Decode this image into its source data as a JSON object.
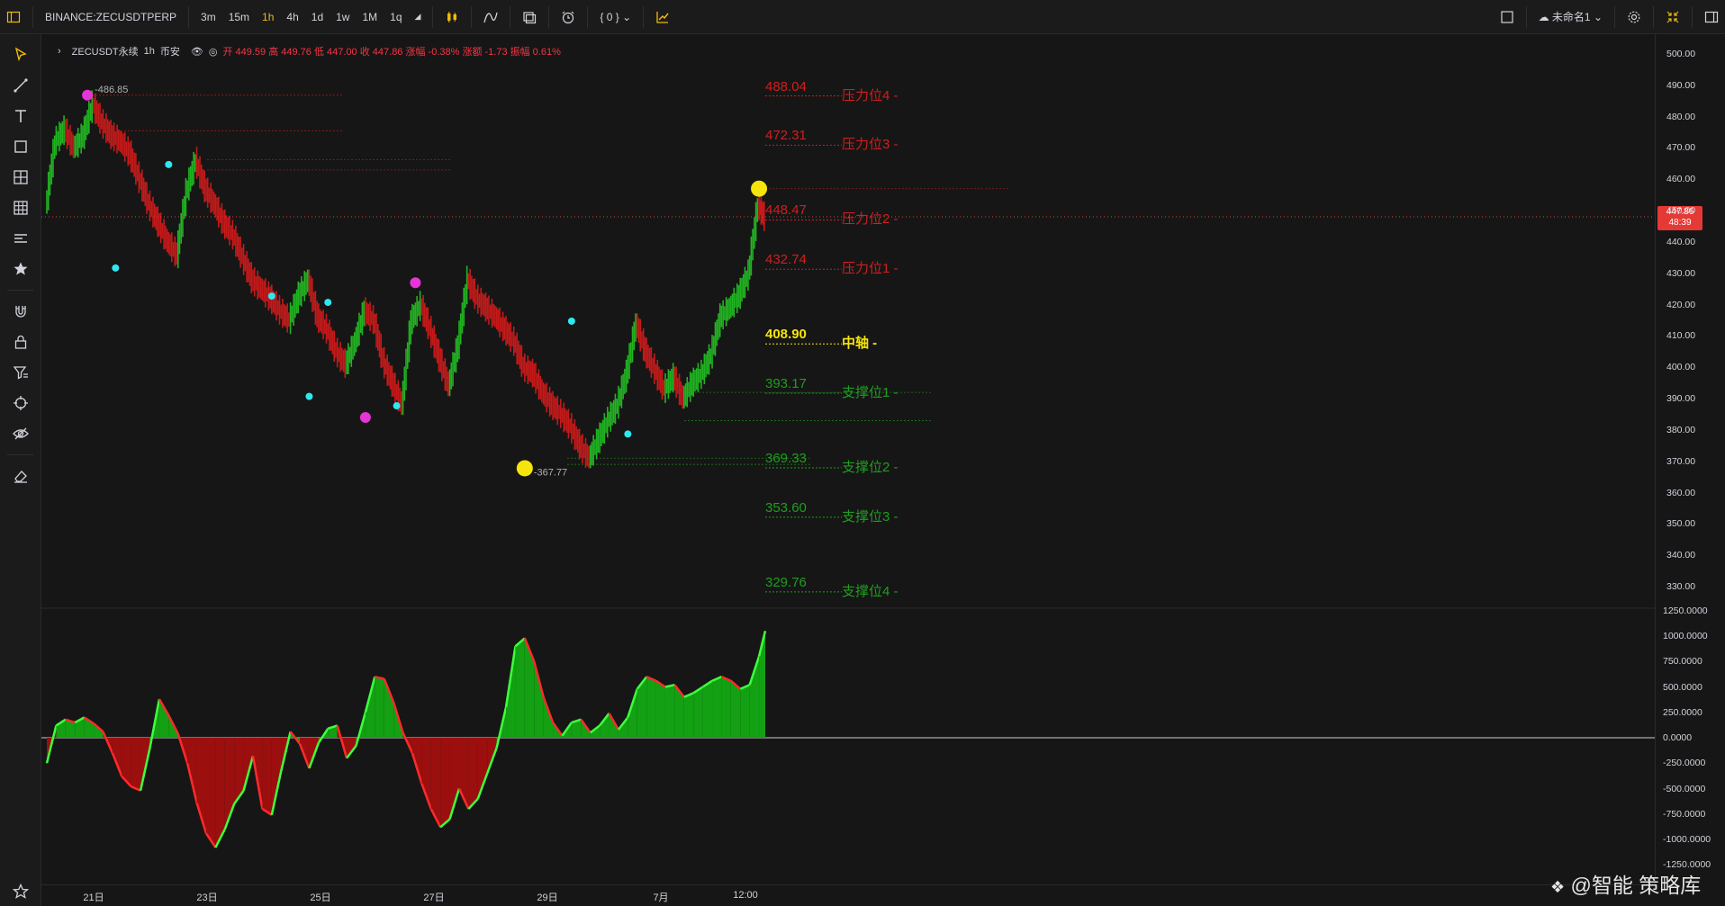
{
  "toolbar": {
    "symbol": "BINANCE:ZECUSDTPERP",
    "intervals": [
      "3m",
      "15m",
      "1h",
      "4h",
      "1d",
      "1w",
      "1M",
      "1q"
    ],
    "active_interval": "1h",
    "indicator_count": "{ 0 }",
    "layout_name": "未命名1"
  },
  "legend": {
    "symbol": "ZECUSDT永续",
    "interval": "1h",
    "exchange": "币安",
    "ohlc": "开 449.59  高 449.76  低 447.00  收 447.86  涨幅 -0.38%  涨额 -1.73  振幅 0.61%"
  },
  "colors": {
    "up": "#22b322",
    "down": "#c41a1a",
    "resistance": "#d21e1e",
    "support": "#1e9e1e",
    "pivot": "#f5e50a",
    "peak_marker": "#e535d6",
    "swing_marker": "#2ee8f0",
    "current_price": "#e53935"
  },
  "current_price_label": {
    "price": "447.86",
    "countdown": "48:39"
  },
  "levels": [
    {
      "value": "488.04",
      "name": "压力位4 -",
      "kind": "resistance"
    },
    {
      "value": "472.31",
      "name": "压力位3 -",
      "kind": "resistance"
    },
    {
      "value": "448.47",
      "name": "压力位2 -",
      "kind": "resistance"
    },
    {
      "value": "432.74",
      "name": "压力位1 -",
      "kind": "resistance"
    },
    {
      "value": "408.90",
      "name": "中轴 -",
      "kind": "pivot"
    },
    {
      "value": "393.17",
      "name": "支撑位1 -",
      "kind": "support"
    },
    {
      "value": "369.33",
      "name": "支撑位2 -",
      "kind": "support"
    },
    {
      "value": "353.60",
      "name": "支撑位3 -",
      "kind": "support"
    },
    {
      "value": "329.76",
      "name": "支撑位4 -",
      "kind": "support"
    }
  ],
  "swing_labels": {
    "high": "486.85",
    "low": "367.77"
  },
  "watermark": "@智能 策略库",
  "chart_data": [
    {
      "type": "line",
      "title": "ZECUSDT永续 1h",
      "price_axis_ticks": [
        "500.00",
        "490.00",
        "480.00",
        "470.00",
        "460.00",
        "450.00",
        "440.00",
        "430.00",
        "420.00",
        "410.00",
        "400.00",
        "390.00",
        "380.00",
        "370.00",
        "360.00",
        "350.00",
        "340.00",
        "330.00"
      ],
      "time_axis_ticks": [
        "21日",
        "23日",
        "25日",
        "27日",
        "29日",
        "7月",
        "12:00"
      ],
      "ylim": [
        325,
        502
      ],
      "x": [
        0,
        6,
        12,
        18,
        24,
        30,
        36,
        42,
        48,
        54,
        60,
        66,
        72,
        78,
        84,
        90,
        96,
        102,
        108,
        114,
        120,
        126,
        132,
        138,
        144,
        150,
        156,
        162,
        168,
        174,
        180,
        186,
        192,
        198,
        204,
        210,
        216,
        222,
        228,
        234,
        240,
        246,
        252,
        258,
        264,
        270,
        276,
        282,
        288,
        294,
        300,
        306,
        312,
        318,
        324,
        330,
        336,
        342,
        348,
        354,
        360,
        366,
        372,
        378,
        384,
        390,
        396,
        402,
        408,
        414,
        420,
        426,
        432,
        438,
        444,
        450,
        456,
        460
      ],
      "close": [
        451,
        472,
        476,
        470,
        474,
        484,
        478,
        474,
        472,
        468,
        460,
        452,
        446,
        440,
        436,
        456,
        466,
        457,
        452,
        446,
        442,
        435,
        428,
        425,
        422,
        418,
        415,
        423,
        428,
        416,
        412,
        405,
        401,
        408,
        418,
        415,
        402,
        395,
        388,
        415,
        420,
        412,
        403,
        394,
        407,
        428,
        422,
        419,
        416,
        412,
        408,
        400,
        398,
        392,
        388,
        385,
        381,
        375,
        371,
        377,
        383,
        388,
        398,
        414,
        405,
        399,
        393,
        397,
        390,
        395,
        398,
        404,
        416,
        419,
        423,
        430,
        452,
        447.86
      ],
      "swing_points": [
        {
          "x": 26,
          "price": 486.85,
          "kind": "peak"
        },
        {
          "x": 44,
          "price": 434,
          "kind": "low"
        },
        {
          "x": 78,
          "price": 463,
          "kind": "high"
        },
        {
          "x": 144,
          "price": 421,
          "kind": "high"
        },
        {
          "x": 168,
          "price": 393,
          "kind": "low"
        },
        {
          "x": 180,
          "price": 419,
          "kind": "high"
        },
        {
          "x": 204,
          "price": 384,
          "kind": "peak"
        },
        {
          "x": 224,
          "price": 390,
          "kind": "low"
        },
        {
          "x": 236,
          "price": 427,
          "kind": "peak"
        },
        {
          "x": 306,
          "price": 367.77,
          "kind": "pivot"
        },
        {
          "x": 336,
          "price": 413,
          "kind": "high"
        },
        {
          "x": 372,
          "price": 381,
          "kind": "low"
        },
        {
          "x": 456,
          "price": 457,
          "kind": "pivot"
        }
      ]
    },
    {
      "type": "area",
      "title": "oscillator",
      "axis_ticks": [
        "1250.0000",
        "1000.0000",
        "750.0000",
        "500.0000",
        "250.0000",
        "0.0000",
        "-250.0000",
        "-500.0000",
        "-750.0000",
        "-1000.0000",
        "-1250.0000"
      ],
      "ylim": [
        -1250,
        1250
      ],
      "x": [
        0,
        6,
        12,
        18,
        24,
        30,
        36,
        42,
        48,
        54,
        60,
        66,
        72,
        78,
        84,
        90,
        96,
        102,
        108,
        114,
        120,
        126,
        132,
        138,
        144,
        150,
        156,
        162,
        168,
        174,
        180,
        186,
        192,
        198,
        204,
        210,
        216,
        222,
        228,
        234,
        240,
        246,
        252,
        258,
        264,
        270,
        276,
        282,
        288,
        294,
        300,
        306,
        312,
        318,
        324,
        330,
        336,
        342,
        348,
        354,
        360,
        366,
        372,
        378,
        384,
        390,
        396,
        402,
        408,
        414,
        420,
        426,
        432,
        438,
        444,
        450,
        456,
        460
      ],
      "values": [
        -250,
        120,
        180,
        150,
        200,
        140,
        60,
        -150,
        -380,
        -480,
        -520,
        -100,
        380,
        220,
        40,
        -250,
        -640,
        -940,
        -1080,
        -900,
        -650,
        -520,
        -180,
        -700,
        -760,
        -330,
        60,
        -60,
        -300,
        -50,
        90,
        120,
        -200,
        -80,
        250,
        600,
        580,
        350,
        50,
        -150,
        -450,
        -700,
        -880,
        -800,
        -500,
        -700,
        -600,
        -350,
        -100,
        300,
        900,
        980,
        750,
        400,
        150,
        20,
        150,
        180,
        50,
        120,
        240,
        80,
        200,
        480,
        600,
        560,
        500,
        520,
        400,
        440,
        500,
        560,
        600,
        560,
        480,
        520,
        800,
        1050
      ]
    }
  ]
}
